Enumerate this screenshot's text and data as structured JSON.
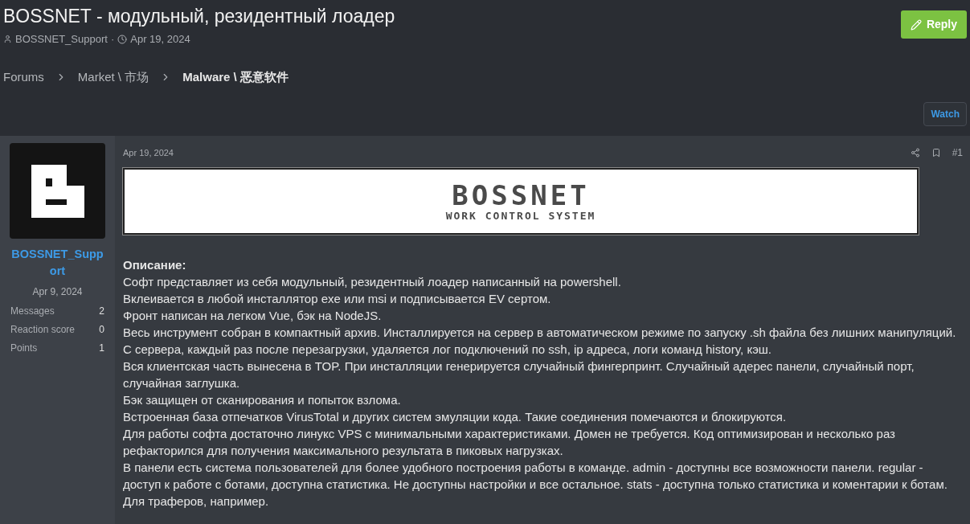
{
  "thread": {
    "title": "BOSSNET - модульный, резидентный лоадер",
    "author": "BOSSNET_Support",
    "separator": "·",
    "date": "Apr 19, 2024"
  },
  "reply_button": {
    "label": "Reply"
  },
  "breadcrumbs": [
    {
      "label": "Forums",
      "current": false
    },
    {
      "label": "Market \\ 市场",
      "current": false
    },
    {
      "label": "Malware \\ 恶意软件",
      "current": true
    }
  ],
  "watch_button": {
    "label": "Watch"
  },
  "user": {
    "name": "BOSSNET_Support",
    "joined": "Apr 9, 2024",
    "stats": [
      {
        "label": "Messages",
        "value": "2"
      },
      {
        "label": "Reaction score",
        "value": "0"
      },
      {
        "label": "Points",
        "value": "1"
      }
    ]
  },
  "post": {
    "date": "Apr 19, 2024",
    "number": "#1",
    "banner": {
      "title": "BOSSNET",
      "subtitle": "WORK CONTROL SYSTEM"
    },
    "heading": "Описание:",
    "paragraphs": [
      "Софт представляет из себя модульный, резидентный лоадер написанный на powershell.",
      "Вклеивается в любой инсталлятор exe или msi и подписывается EV сертом.",
      "Фронт написан на легком Vue, бэк на NodeJS.",
      "Весь инструмент собран в компактный архив. Инсталлируется на сервер в автоматическом режиме по запуску .sh файла без лишних манипуляций.",
      "С сервера, каждый раз после перезагрузки, удаляется лог подключений по ssh, ip адреса, логи команд history, кэш.",
      "Вся клиентская часть вынесена в TOP. При инсталляции генерируется случайный фингерпринт. Случайный адерес панели, случайный порт, случайная заглушка.",
      "Бэк защищен от сканирования и попыток взлома.",
      "Встроенная база отпечатков VirusTotal и других систем эмуляции кода. Такие соединения помечаются и блокируются.",
      "Для работы софта достаточно линукс VPS с минимальными характеристиками. Домен не требуется. Код оптимизирован и несколько раз рефакторился для получения максимального результата в пиковых нагрузках.",
      "В панели есть система пользователей для более удобного построения работы в команде. admin - доступны все возможности панели. regular - доступ к работе с ботами, доступна статистика. Не доступны настройки и все остальное. stats - доступна только статистика и коментарии к ботам.",
      "Для траферов, например."
    ]
  }
}
